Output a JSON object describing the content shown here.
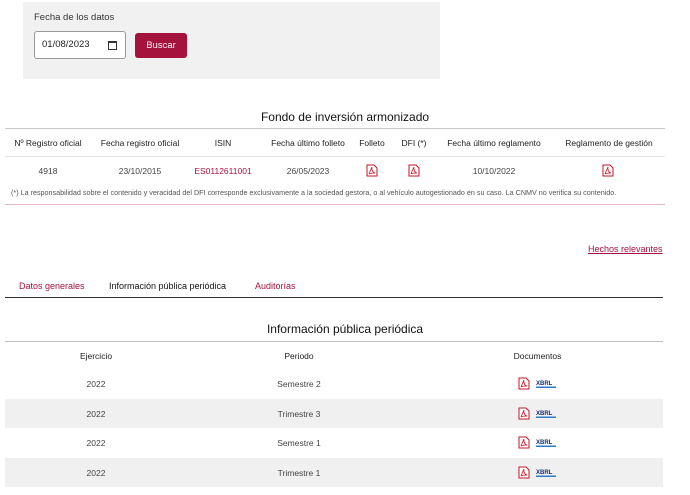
{
  "filter": {
    "label": "Fecha de los datos",
    "date_value": "01/08/2023",
    "search_label": "Buscar"
  },
  "fund": {
    "title": "Fondo de inversión armonizado",
    "columns": [
      "Nº Registro oficial",
      "Fecha registro oficial",
      "ISIN",
      "Fecha último folleto",
      "Folleto",
      "DFI (*)",
      "Fecha último reglamento",
      "Reglamento de gestión"
    ],
    "row": {
      "registro": "4918",
      "fecha_registro": "23/10/2015",
      "isin": "ES0112611001",
      "fecha_folleto": "26/05/2023",
      "fecha_reglamento": "10/10/2022"
    },
    "note": "(*) La responsabilidad sobre el contenido y veracidad del DFI corresponde exclusivamente a la sociedad gestora, o al vehículo autogestionado en su caso. La CNMV no verifica su contenido."
  },
  "hechos_link": "Hechos relevantes",
  "tabs": [
    "Datos generales",
    "Información pública periódica",
    "Auditorías"
  ],
  "ipp": {
    "title": "Información pública periódica",
    "columns": [
      "Ejercicio",
      "Periodo",
      "Documentos"
    ],
    "rows": [
      {
        "ejercicio": "2022",
        "periodo": "Semestre 2"
      },
      {
        "ejercicio": "2022",
        "periodo": "Trimestre 3"
      },
      {
        "ejercicio": "2022",
        "periodo": "Semestre 1"
      },
      {
        "ejercicio": "2022",
        "periodo": "Trimestre 1"
      }
    ]
  },
  "icons": {
    "pdf": "pdf-icon",
    "xbrl": "xbrl-icon",
    "calendar": "calendar-icon"
  },
  "colors": {
    "accent": "#a5123b",
    "panel_bg": "#f1f1f1",
    "row_alt": "#f0f0f0"
  }
}
